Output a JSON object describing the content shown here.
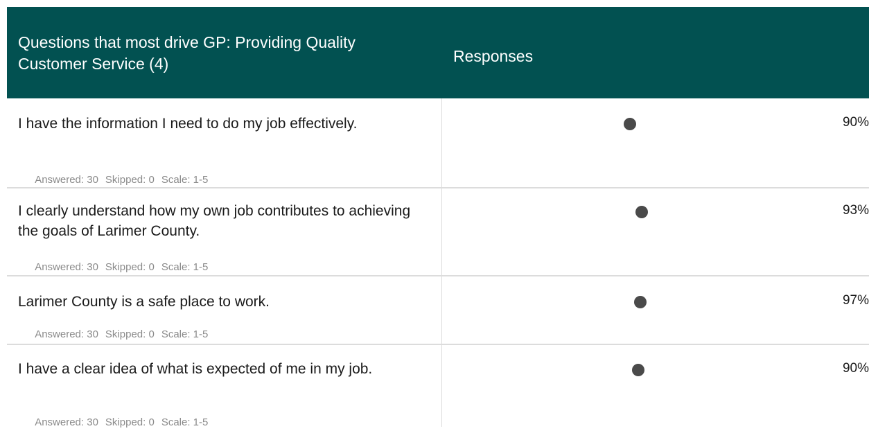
{
  "header": {
    "question_col": "Questions that most drive GP: Providing Quality Customer Service (4)",
    "responses_col": "Responses"
  },
  "rows": [
    {
      "question": "I have the information I need to do my job effectively.",
      "answered": "Answered: 30",
      "skipped": "Skipped: 0",
      "scale": "Scale: 1-5",
      "percent": "90%"
    },
    {
      "question": "I clearly understand how my own job contributes to achieving the goals of Larimer County.",
      "answered": "Answered: 30",
      "skipped": "Skipped: 0",
      "scale": "Scale: 1-5",
      "percent": "93%"
    },
    {
      "question": "Larimer County is a safe place to work.",
      "answered": "Answered: 30",
      "skipped": "Skipped: 0",
      "scale": "Scale: 1-5",
      "percent": "97%"
    },
    {
      "question": "I have a clear idea of what is expected of me in my job.",
      "answered": "Answered: 30",
      "skipped": "Skipped: 0",
      "scale": "Scale: 1-5",
      "percent": "90%"
    }
  ],
  "colors": {
    "header_bg": "#025151",
    "header_text": "#ffffff",
    "dot": "#4a4a4a",
    "meta_text": "#8a8a8a"
  }
}
